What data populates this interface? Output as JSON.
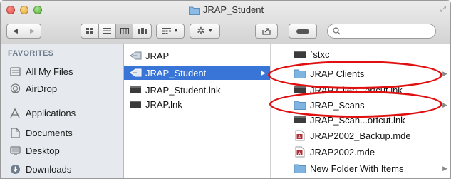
{
  "window": {
    "title": "JRAP_Student"
  },
  "toolbar": {
    "back_label": "◀",
    "forward_label": "▶",
    "search_placeholder": "",
    "search_value": ""
  },
  "sidebar": {
    "header": "FAVORITES",
    "items": [
      {
        "label": "All My Files",
        "icon": "all-files-icon"
      },
      {
        "label": "AirDrop",
        "icon": "airdrop-icon"
      },
      {
        "label": "Applications",
        "icon": "applications-icon"
      },
      {
        "label": "Documents",
        "icon": "documents-icon"
      },
      {
        "label": "Desktop",
        "icon": "desktop-icon"
      },
      {
        "label": "Downloads",
        "icon": "downloads-icon"
      }
    ]
  },
  "column1": {
    "items": [
      {
        "label": "JRAP",
        "icon": "alias-icon",
        "has_children": false
      },
      {
        "label": "JRAP_Student",
        "icon": "alias-icon",
        "has_children": true,
        "selected": true
      },
      {
        "label": "JRAP_Student.lnk",
        "icon": "lnk-file-icon",
        "has_children": false
      },
      {
        "label": "JRAP.lnk",
        "icon": "lnk-file-icon",
        "has_children": false
      }
    ]
  },
  "column2": {
    "items": [
      {
        "label": "`stxc",
        "icon": "lnk-file-icon",
        "has_children": true
      },
      {
        "label": "JRAP Clients",
        "icon": "folder-icon",
        "has_children": true
      },
      {
        "label": "JRAP Clien...ortcut.lnk",
        "icon": "lnk-file-icon",
        "has_children": false
      },
      {
        "label": "JRAP_Scans",
        "icon": "folder-icon",
        "has_children": true
      },
      {
        "label": "JRAP_Scan...ortcut.lnk",
        "icon": "lnk-file-icon",
        "has_children": false
      },
      {
        "label": "JRAP2002_Backup.mde",
        "icon": "access-file-icon",
        "has_children": false
      },
      {
        "label": "JRAP2002.mde",
        "icon": "access-file-icon",
        "has_children": false
      },
      {
        "label": "New Folder With Items",
        "icon": "folder-icon",
        "has_children": true
      }
    ]
  },
  "colors": {
    "selection": "#3875d7",
    "annotation": "#e01010",
    "folder": "#7fb3e0"
  }
}
